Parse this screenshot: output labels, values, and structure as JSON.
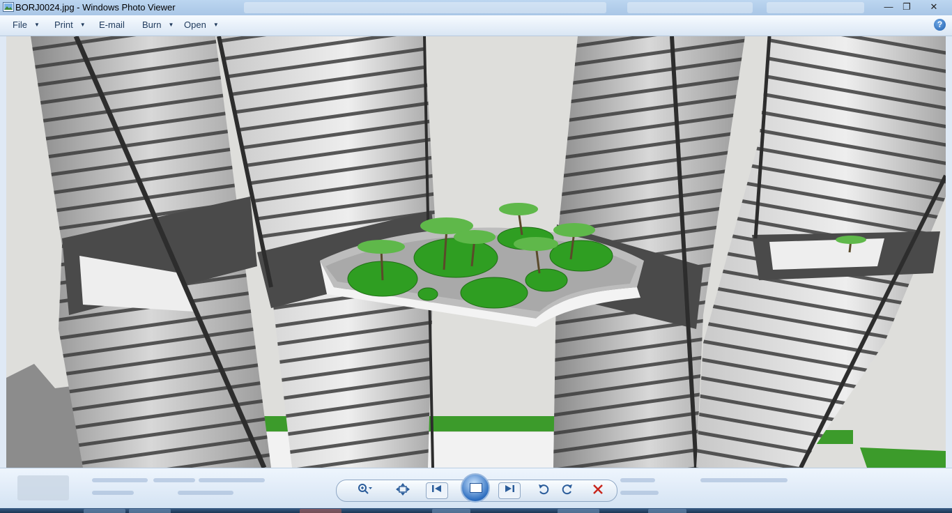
{
  "window": {
    "title": "BORJ0024.jpg - Windows Photo Viewer",
    "minimize_label": "—",
    "restore_label": "❐",
    "close_label": "✕"
  },
  "menu": {
    "file_label": "File",
    "print_label": "Print",
    "email_label": "E-mail",
    "burn_label": "Burn",
    "open_label": "Open",
    "dropdown_arrow": "▼",
    "help_label": "?"
  },
  "controls": {
    "zoom_icon": "magnifier-zoom",
    "actual_size_icon": "fit-window",
    "previous_icon": "skip-previous",
    "slideshow_icon": "play-slideshow",
    "next_icon": "skip-next",
    "rotate_ccw_icon": "rotate-counterclockwise",
    "rotate_cw_icon": "rotate-clockwise",
    "delete_icon": "delete-x",
    "delete_color": "#c8261c"
  },
  "colors": {
    "accent": "#2a5c9a",
    "titlebar": "#bcd6f0",
    "grass": "#3a9d2a"
  }
}
